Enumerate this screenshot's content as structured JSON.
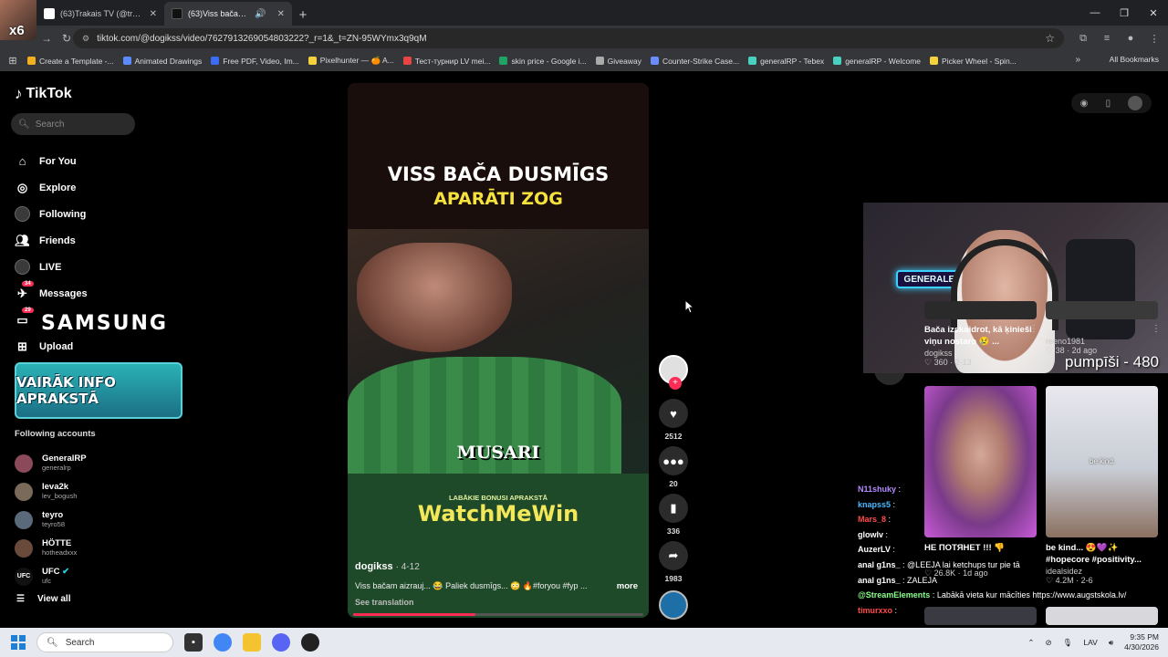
{
  "browser": {
    "tabs": [
      {
        "title": "(63)Trakais TV (@trakais_viking..."
      },
      {
        "title": "(63)Viss bačam aizrauj... 😂"
      }
    ],
    "profile_badge": "x6",
    "url": "tiktok.com/@dogikss/video/7627913269054803222?_r=1&_t=ZN-95WYmx3q9qM",
    "bookmarks": [
      {
        "label": "Create a Template -...",
        "color": "#f2b01e"
      },
      {
        "label": "Animated Drawings",
        "color": "#5a8cff"
      },
      {
        "label": "Free PDF, Video, Im...",
        "color": "#3b6cf5"
      },
      {
        "label": "Pixelhunter — 🍊 A...",
        "color": "#f5d23b"
      },
      {
        "label": "Тест-турнир LV mei...",
        "color": "#e94444"
      },
      {
        "label": "skin price - Google i...",
        "color": "#1fa463"
      },
      {
        "label": "Giveaway",
        "color": "#aaaaaa"
      },
      {
        "label": "Counter-Strike Case...",
        "color": "#6a8cff"
      },
      {
        "label": "generalRP - Tebex",
        "color": "#4ad0c0"
      },
      {
        "label": "generalRP - Welcome",
        "color": "#4ad0c0"
      },
      {
        "label": "Picker Wheel - Spin...",
        "color": "#f5d23b"
      }
    ],
    "all_bookmarks": "All Bookmarks"
  },
  "sidebar": {
    "logo": "TikTok",
    "search_placeholder": "Search",
    "nav": [
      {
        "label": "For You",
        "icon": "home-icon"
      },
      {
        "label": "Explore",
        "icon": "compass-icon"
      },
      {
        "label": "Following",
        "icon": "following-avatar-icon"
      },
      {
        "label": "Friends",
        "icon": "friends-icon"
      },
      {
        "label": "LIVE",
        "icon": "live-icon"
      },
      {
        "label": "Messages",
        "icon": "messages-icon",
        "badge": "34"
      },
      {
        "label": "Upload",
        "icon": "upload-icon"
      }
    ],
    "activity_badge": "29",
    "sponsor": "SAMSUNG",
    "promo_banner": "VAIRĀK INFO APRAKSTĀ",
    "following_title": "Following accounts",
    "accounts": [
      {
        "name": "GeneralRP",
        "handle": "generalrp",
        "color": "#8a4a5a"
      },
      {
        "name": "Ieva2k",
        "handle": "lev_bogush",
        "color": "#7a6a5a"
      },
      {
        "name": "teyro",
        "handle": "teyro58",
        "color": "#5a6a7a"
      },
      {
        "name": "HÖTTE",
        "handle": "hotheadxxx",
        "color": "#6a4a3a"
      },
      {
        "name": "UFC",
        "handle": "ufc",
        "color": "#111111",
        "verified": true
      }
    ],
    "view_all": "View all"
  },
  "video": {
    "headline_1": "VISS BAČA DUSMĪGS",
    "headline_2": "APARĀTI ZOG",
    "caption_overlay": "MUSARI",
    "bonus_text": "LABĀKIE BONUSI APRAKSTĀ",
    "brand": "WatchMeWin",
    "author": "dogikss",
    "date": "4-12",
    "description": "Viss bačam aizrauj... 😂 Paliek dusmīgs... 😳 🔥#foryou #fyp ...",
    "more": "more",
    "see_translation": "See translation",
    "progress": 0.42
  },
  "actions": {
    "likes": "2512",
    "comments": "20",
    "saves": "336",
    "shares": "1983"
  },
  "stream_overlay": {
    "neon_sign": "GENERALEXE",
    "goal_text": "pumpīši - 480"
  },
  "recommended": [
    {
      "title": "Bača izskaidrot, kā ķinieši viņu nostaro 😢 ...",
      "author": "dogikss",
      "likes": "360",
      "date": "2-13"
    },
    {
      "title": "",
      "author": "reeno1981",
      "likes": "38",
      "date": "2d ago"
    },
    {
      "title": "НЕ ПОТЯНЕТ !!! 👎",
      "author": "",
      "likes": "26.8K",
      "date": "1d ago"
    },
    {
      "title": "be kind... 😍💜✨ #hopecore #positivity...",
      "author": "idealsidez",
      "likes": "4.2M",
      "date": "2-6",
      "overlay": "be kind."
    }
  ],
  "chat": [
    {
      "user": "N11shuky",
      "msg": "",
      "color_class": "c1"
    },
    {
      "user": "knapss5",
      "msg": "",
      "color_class": "c2"
    },
    {
      "user": "Mars_8",
      "msg": "",
      "color_class": "c3"
    },
    {
      "user": "glowlv",
      "msg": "",
      "color_class": "c4"
    },
    {
      "user": "AuzerLV",
      "msg": "",
      "color_class": "c4"
    },
    {
      "user": "anal g1ns_",
      "msg": "@LEEJA lai ketchups tur pie tā",
      "color_class": "c4"
    },
    {
      "user": "anal g1ns_",
      "msg": "ZALEJA",
      "color_class": "c4"
    },
    {
      "user": "@StreamElements",
      "msg": "Labākā vieta kur mācīties https://www.augstskola.lv/",
      "color_class": "c5"
    },
    {
      "user": "timurxxo",
      "msg": "",
      "color_class": "c3"
    }
  ],
  "taskbar": {
    "search": "Search",
    "lang": "LAV",
    "time": "9:35 PM",
    "date": "4/30/2026"
  }
}
